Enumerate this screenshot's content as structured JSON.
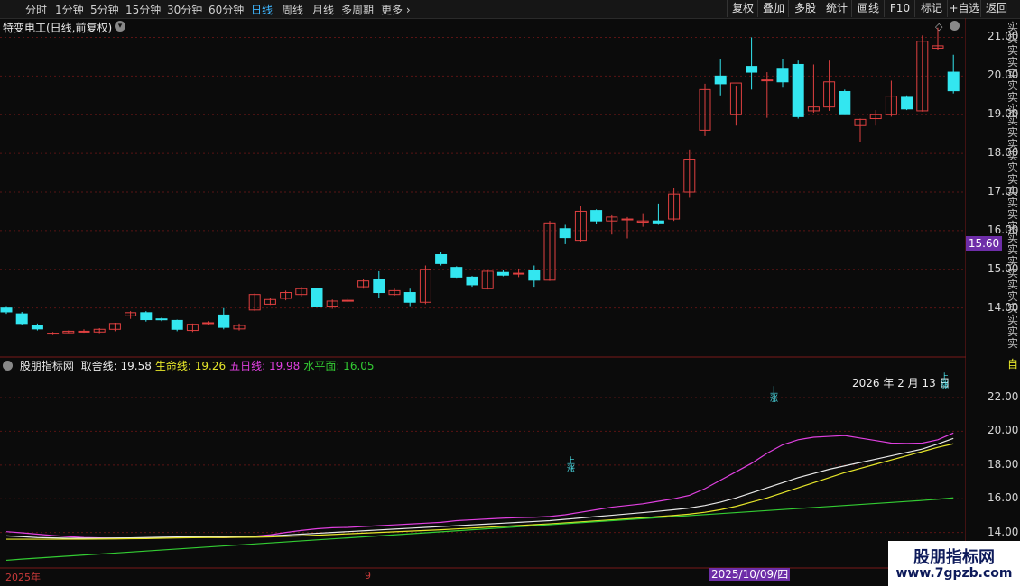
{
  "toolbar": {
    "periods": [
      "分时",
      "1分钟",
      "5分钟",
      "15分钟",
      "30分钟",
      "60分钟",
      "日线",
      "周线",
      "月线",
      "多周期",
      "更多"
    ],
    "active_period": "日线",
    "right_buttons": [
      "复权",
      "叠加",
      "多股",
      "统计",
      "画线",
      "F10",
      "标记",
      "+自选",
      "返回"
    ]
  },
  "title": {
    "text": "特变电工(日线,前复权)"
  },
  "price_axis": {
    "ticks": [
      "21.00",
      "20.00",
      "19.00",
      "18.00",
      "17.00",
      "16.00",
      "15.00",
      "14.00"
    ],
    "current_price": "15.60"
  },
  "indicator": {
    "name": "股朋指标网",
    "lines": [
      {
        "label": "取舍线:",
        "value": "19.58",
        "color": "#e8e8e8"
      },
      {
        "label": "生命线:",
        "value": "19.26",
        "color": "#e6e62a"
      },
      {
        "label": "五日线:",
        "value": "19.98",
        "color": "#e040e0"
      },
      {
        "label": "水平面:",
        "value": "16.05",
        "color": "#33cc33"
      }
    ],
    "ticks": [
      "22.00",
      "20.00",
      "18.00",
      "16.00",
      "14.00"
    ],
    "date_annotation": "2026 年 2 月 13 日",
    "markers": [
      "上涨",
      "上涨",
      "上涨"
    ]
  },
  "x_axis": {
    "labels": [
      "2025年",
      "9"
    ],
    "cursor_date": "2025/10/09/四"
  },
  "watermark": {
    "line1": "股朋指标网",
    "line2": "www.7gpzb.com"
  },
  "right_strip": {
    "top_char": "实",
    "mid_char": "自"
  },
  "colors": {
    "up": "#e04040",
    "down": "#33e6f0",
    "bg": "#0b0b0b",
    "grid": "#5a1414"
  },
  "chart_data": {
    "type": "candlestick",
    "ylim": [
      13.2,
      21.5
    ],
    "candles": [
      [
        14.0,
        14.05,
        13.85,
        13.9
      ],
      [
        13.85,
        13.9,
        13.55,
        13.6
      ],
      [
        13.55,
        13.6,
        13.42,
        13.46
      ],
      [
        13.33,
        13.38,
        13.3,
        13.35
      ],
      [
        13.36,
        13.42,
        13.35,
        13.4
      ],
      [
        13.38,
        13.45,
        13.36,
        13.4
      ],
      [
        13.38,
        13.48,
        13.35,
        13.45
      ],
      [
        13.45,
        13.62,
        13.4,
        13.6
      ],
      [
        13.8,
        13.92,
        13.72,
        13.88
      ],
      [
        13.88,
        13.92,
        13.65,
        13.7
      ],
      [
        13.72,
        13.75,
        13.66,
        13.7
      ],
      [
        13.68,
        13.7,
        13.4,
        13.45
      ],
      [
        13.42,
        13.6,
        13.38,
        13.58
      ],
      [
        13.6,
        13.66,
        13.55,
        13.62
      ],
      [
        13.82,
        14.0,
        13.45,
        13.5
      ],
      [
        13.46,
        13.6,
        13.42,
        13.55
      ],
      [
        13.95,
        14.38,
        13.92,
        14.35
      ],
      [
        14.1,
        14.25,
        14.08,
        14.22
      ],
      [
        14.25,
        14.45,
        14.2,
        14.4
      ],
      [
        14.35,
        14.55,
        14.3,
        14.5
      ],
      [
        14.5,
        14.52,
        14.02,
        14.05
      ],
      [
        14.05,
        14.22,
        13.98,
        14.18
      ],
      [
        14.2,
        14.25,
        14.15,
        14.2
      ],
      [
        14.55,
        14.75,
        14.5,
        14.7
      ],
      [
        14.75,
        14.95,
        14.25,
        14.4
      ],
      [
        14.35,
        14.5,
        14.32,
        14.45
      ],
      [
        14.4,
        14.5,
        14.05,
        14.15
      ],
      [
        14.15,
        15.1,
        14.1,
        15.0
      ],
      [
        15.38,
        15.45,
        15.1,
        15.15
      ],
      [
        15.05,
        15.08,
        14.78,
        14.8
      ],
      [
        14.8,
        14.83,
        14.55,
        14.6
      ],
      [
        14.5,
        14.98,
        14.48,
        14.95
      ],
      [
        14.92,
        14.98,
        14.82,
        14.85
      ],
      [
        14.88,
        15.02,
        14.8,
        14.9
      ],
      [
        14.98,
        15.1,
        14.55,
        14.72
      ],
      [
        14.72,
        16.25,
        14.7,
        16.2
      ],
      [
        16.05,
        16.15,
        15.65,
        15.82
      ],
      [
        15.75,
        16.65,
        15.72,
        16.5
      ],
      [
        16.52,
        16.55,
        16.18,
        16.25
      ],
      [
        16.25,
        16.42,
        15.9,
        16.35
      ],
      [
        16.3,
        16.35,
        15.8,
        16.3
      ],
      [
        16.22,
        16.45,
        16.1,
        16.25
      ],
      [
        16.25,
        16.7,
        16.15,
        16.2
      ],
      [
        16.3,
        17.1,
        16.25,
        16.95
      ],
      [
        17.0,
        18.1,
        16.85,
        17.85
      ],
      [
        18.6,
        19.8,
        18.45,
        19.65
      ],
      [
        20.0,
        20.45,
        19.5,
        19.8
      ],
      [
        19.0,
        19.75,
        18.72,
        19.82
      ],
      [
        20.25,
        21.0,
        19.65,
        20.1
      ],
      [
        19.9,
        20.1,
        18.92,
        19.9
      ],
      [
        20.2,
        20.45,
        19.7,
        19.85
      ],
      [
        20.3,
        20.4,
        18.9,
        18.95
      ],
      [
        19.1,
        20.3,
        19.05,
        19.2
      ],
      [
        19.2,
        20.4,
        19.1,
        19.85
      ],
      [
        19.6,
        19.65,
        19.0,
        19.0
      ],
      [
        18.72,
        18.9,
        18.3,
        18.88
      ],
      [
        18.9,
        19.12,
        18.72,
        19.0
      ],
      [
        19.0,
        19.88,
        18.95,
        19.48
      ],
      [
        19.45,
        19.5,
        19.12,
        19.15
      ],
      [
        19.1,
        21.05,
        19.08,
        20.9
      ],
      [
        20.72,
        21.25,
        20.68,
        20.78
      ],
      [
        20.1,
        20.55,
        19.55,
        19.62
      ]
    ],
    "ind_series": {
      "magenta": [
        14.05,
        13.98,
        13.9,
        13.82,
        13.75,
        13.7,
        13.68,
        13.66,
        13.66,
        13.68,
        13.7,
        13.72,
        13.72,
        13.72,
        13.7,
        13.72,
        13.78,
        13.86,
        14.0,
        14.12,
        14.22,
        14.28,
        14.3,
        14.35,
        14.4,
        14.45,
        14.5,
        14.55,
        14.6,
        14.7,
        14.75,
        14.8,
        14.85,
        14.88,
        14.9,
        14.95,
        15.05,
        15.2,
        15.35,
        15.5,
        15.6,
        15.7,
        15.85,
        16.0,
        16.2,
        16.6,
        17.1,
        17.6,
        18.1,
        18.7,
        19.2,
        19.5,
        19.65,
        19.7,
        19.75,
        19.6,
        19.45,
        19.3,
        19.28,
        19.3,
        19.5,
        19.9
      ],
      "white": [
        13.8,
        13.75,
        13.7,
        13.68,
        13.66,
        13.66,
        13.66,
        13.67,
        13.68,
        13.7,
        13.72,
        13.73,
        13.74,
        13.74,
        13.74,
        13.75,
        13.77,
        13.8,
        13.85,
        13.9,
        13.95,
        14.0,
        14.05,
        14.1,
        14.15,
        14.2,
        14.25,
        14.3,
        14.35,
        14.4,
        14.45,
        14.5,
        14.55,
        14.6,
        14.65,
        14.7,
        14.78,
        14.86,
        14.94,
        15.02,
        15.1,
        15.18,
        15.26,
        15.35,
        15.45,
        15.6,
        15.8,
        16.05,
        16.35,
        16.65,
        16.95,
        17.25,
        17.5,
        17.75,
        17.95,
        18.15,
        18.35,
        18.55,
        18.75,
        18.95,
        19.25,
        19.58
      ],
      "yellow": [
        13.6,
        13.6,
        13.6,
        13.6,
        13.6,
        13.6,
        13.61,
        13.62,
        13.63,
        13.64,
        13.66,
        13.68,
        13.69,
        13.7,
        13.7,
        13.71,
        13.72,
        13.74,
        13.77,
        13.8,
        13.84,
        13.88,
        13.92,
        13.96,
        14.0,
        14.04,
        14.08,
        14.12,
        14.16,
        14.21,
        14.26,
        14.31,
        14.36,
        14.41,
        14.46,
        14.51,
        14.57,
        14.63,
        14.69,
        14.75,
        14.81,
        14.87,
        14.94,
        15.01,
        15.09,
        15.2,
        15.35,
        15.55,
        15.8,
        16.05,
        16.35,
        16.65,
        16.95,
        17.25,
        17.55,
        17.8,
        18.05,
        18.3,
        18.55,
        18.8,
        19.05,
        19.26
      ],
      "green": [
        12.35,
        12.42,
        12.48,
        12.54,
        12.6,
        12.66,
        12.72,
        12.78,
        12.84,
        12.9,
        12.96,
        13.02,
        13.08,
        13.14,
        13.2,
        13.26,
        13.32,
        13.38,
        13.44,
        13.5,
        13.56,
        13.62,
        13.68,
        13.74,
        13.8,
        13.86,
        13.92,
        13.98,
        14.04,
        14.1,
        14.16,
        14.22,
        14.28,
        14.34,
        14.4,
        14.46,
        14.52,
        14.58,
        14.64,
        14.7,
        14.76,
        14.82,
        14.88,
        14.94,
        15.0,
        15.06,
        15.12,
        15.18,
        15.24,
        15.3,
        15.36,
        15.42,
        15.48,
        15.54,
        15.6,
        15.66,
        15.72,
        15.78,
        15.84,
        15.9,
        15.97,
        16.05
      ]
    },
    "ind_ylim": [
      12.0,
      23.5
    ]
  }
}
